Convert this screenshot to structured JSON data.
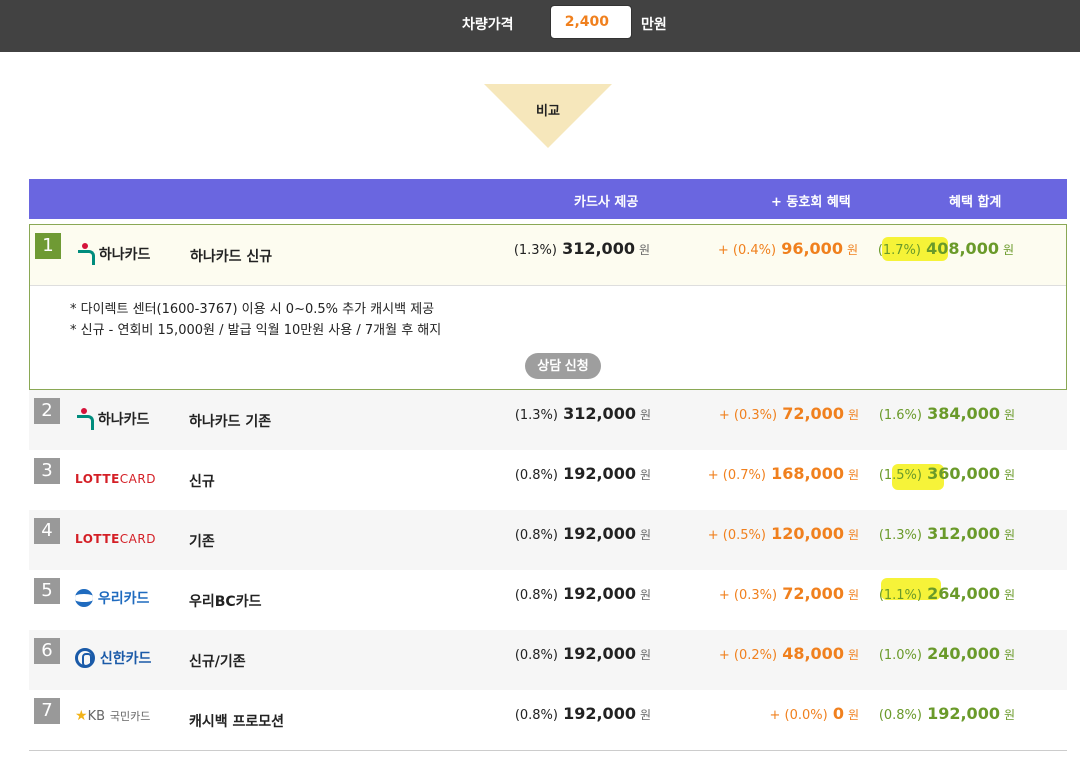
{
  "topbar": {
    "price_label": "차량가격",
    "price_value": "2,400",
    "unit": "만원"
  },
  "compare_label": "비교",
  "table_header": {
    "card_company": "카드사 제공",
    "club_benefit": "+ 동호회 혜택",
    "total_benefit": "혜택 합계"
  },
  "currency": "원",
  "rows": [
    {
      "rank": "1",
      "logo": "하나카드",
      "product": "하나카드 신규",
      "card_pct": "(1.3%)",
      "card_amt": "312,000",
      "club_pct": "+ (0.4%)",
      "club_amt": "96,000",
      "total_pct": "(1.7%)",
      "total_amt": "408,000",
      "notes": [
        "* 다이렉트 센터(1600-3767) 이용 시 0~0.5% 추가 캐시백 제공",
        "* 신규 - 연회비 15,000원 / 발급 익월 10만원 사용 / 7개월 후 해지"
      ],
      "button": "상담 신청"
    },
    {
      "rank": "2",
      "logo": "하나카드",
      "product": "하나카드 기존",
      "card_pct": "(1.3%)",
      "card_amt": "312,000",
      "club_pct": "+ (0.3%)",
      "club_amt": "72,000",
      "total_pct": "(1.6%)",
      "total_amt": "384,000"
    },
    {
      "rank": "3",
      "logo_main": "LOTTE",
      "logo_sub": "CARD",
      "product": "신규",
      "card_pct": "(0.8%)",
      "card_amt": "192,000",
      "club_pct": "+ (0.7%)",
      "club_amt": "168,000",
      "total_pct": "(1.5%)",
      "total_amt": "360,000"
    },
    {
      "rank": "4",
      "logo_main": "LOTTE",
      "logo_sub": "CARD",
      "product": "기존",
      "card_pct": "(0.8%)",
      "card_amt": "192,000",
      "club_pct": "+ (0.5%)",
      "club_amt": "120,000",
      "total_pct": "(1.3%)",
      "total_amt": "312,000"
    },
    {
      "rank": "5",
      "logo": "우리카드",
      "product": "우리BC카드",
      "card_pct": "(0.8%)",
      "card_amt": "192,000",
      "club_pct": "+ (0.3%)",
      "club_amt": "72,000",
      "total_pct": "(1.1%)",
      "total_amt": "264,000"
    },
    {
      "rank": "6",
      "logo": "신한카드",
      "product": "신규/기존",
      "card_pct": "(0.8%)",
      "card_amt": "192,000",
      "club_pct": "+ (0.2%)",
      "club_amt": "48,000",
      "total_pct": "(1.0%)",
      "total_amt": "240,000"
    },
    {
      "rank": "7",
      "logo_mark": "KB",
      "logo_sub": "국민카드",
      "product": "캐시백 프로모션",
      "card_pct": "(0.8%)",
      "card_amt": "192,000",
      "club_pct": "+ (0.0%)",
      "club_amt": "0",
      "total_pct": "(0.8%)",
      "total_amt": "192,000"
    }
  ],
  "colors": {
    "topbar": "#424242",
    "header": "#6a66e0",
    "club_orange": "#f0801e",
    "total_green": "#6a9a2a",
    "rank_green": "#6f9a34",
    "rank_gray": "#999999",
    "highlighter": "#f4f116"
  }
}
